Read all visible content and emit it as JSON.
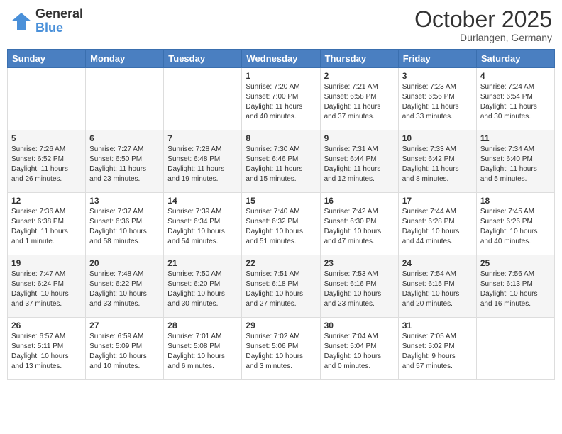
{
  "header": {
    "logo": {
      "general": "General",
      "blue": "Blue"
    },
    "title": "October 2025",
    "subtitle": "Durlangen, Germany"
  },
  "weekdays": [
    "Sunday",
    "Monday",
    "Tuesday",
    "Wednesday",
    "Thursday",
    "Friday",
    "Saturday"
  ],
  "weeks": [
    [
      {
        "day": "",
        "info": ""
      },
      {
        "day": "",
        "info": ""
      },
      {
        "day": "",
        "info": ""
      },
      {
        "day": "1",
        "info": "Sunrise: 7:20 AM\nSunset: 7:00 PM\nDaylight: 11 hours\nand 40 minutes."
      },
      {
        "day": "2",
        "info": "Sunrise: 7:21 AM\nSunset: 6:58 PM\nDaylight: 11 hours\nand 37 minutes."
      },
      {
        "day": "3",
        "info": "Sunrise: 7:23 AM\nSunset: 6:56 PM\nDaylight: 11 hours\nand 33 minutes."
      },
      {
        "day": "4",
        "info": "Sunrise: 7:24 AM\nSunset: 6:54 PM\nDaylight: 11 hours\nand 30 minutes."
      }
    ],
    [
      {
        "day": "5",
        "info": "Sunrise: 7:26 AM\nSunset: 6:52 PM\nDaylight: 11 hours\nand 26 minutes."
      },
      {
        "day": "6",
        "info": "Sunrise: 7:27 AM\nSunset: 6:50 PM\nDaylight: 11 hours\nand 23 minutes."
      },
      {
        "day": "7",
        "info": "Sunrise: 7:28 AM\nSunset: 6:48 PM\nDaylight: 11 hours\nand 19 minutes."
      },
      {
        "day": "8",
        "info": "Sunrise: 7:30 AM\nSunset: 6:46 PM\nDaylight: 11 hours\nand 15 minutes."
      },
      {
        "day": "9",
        "info": "Sunrise: 7:31 AM\nSunset: 6:44 PM\nDaylight: 11 hours\nand 12 minutes."
      },
      {
        "day": "10",
        "info": "Sunrise: 7:33 AM\nSunset: 6:42 PM\nDaylight: 11 hours\nand 8 minutes."
      },
      {
        "day": "11",
        "info": "Sunrise: 7:34 AM\nSunset: 6:40 PM\nDaylight: 11 hours\nand 5 minutes."
      }
    ],
    [
      {
        "day": "12",
        "info": "Sunrise: 7:36 AM\nSunset: 6:38 PM\nDaylight: 11 hours\nand 1 minute."
      },
      {
        "day": "13",
        "info": "Sunrise: 7:37 AM\nSunset: 6:36 PM\nDaylight: 10 hours\nand 58 minutes."
      },
      {
        "day": "14",
        "info": "Sunrise: 7:39 AM\nSunset: 6:34 PM\nDaylight: 10 hours\nand 54 minutes."
      },
      {
        "day": "15",
        "info": "Sunrise: 7:40 AM\nSunset: 6:32 PM\nDaylight: 10 hours\nand 51 minutes."
      },
      {
        "day": "16",
        "info": "Sunrise: 7:42 AM\nSunset: 6:30 PM\nDaylight: 10 hours\nand 47 minutes."
      },
      {
        "day": "17",
        "info": "Sunrise: 7:44 AM\nSunset: 6:28 PM\nDaylight: 10 hours\nand 44 minutes."
      },
      {
        "day": "18",
        "info": "Sunrise: 7:45 AM\nSunset: 6:26 PM\nDaylight: 10 hours\nand 40 minutes."
      }
    ],
    [
      {
        "day": "19",
        "info": "Sunrise: 7:47 AM\nSunset: 6:24 PM\nDaylight: 10 hours\nand 37 minutes."
      },
      {
        "day": "20",
        "info": "Sunrise: 7:48 AM\nSunset: 6:22 PM\nDaylight: 10 hours\nand 33 minutes."
      },
      {
        "day": "21",
        "info": "Sunrise: 7:50 AM\nSunset: 6:20 PM\nDaylight: 10 hours\nand 30 minutes."
      },
      {
        "day": "22",
        "info": "Sunrise: 7:51 AM\nSunset: 6:18 PM\nDaylight: 10 hours\nand 27 minutes."
      },
      {
        "day": "23",
        "info": "Sunrise: 7:53 AM\nSunset: 6:16 PM\nDaylight: 10 hours\nand 23 minutes."
      },
      {
        "day": "24",
        "info": "Sunrise: 7:54 AM\nSunset: 6:15 PM\nDaylight: 10 hours\nand 20 minutes."
      },
      {
        "day": "25",
        "info": "Sunrise: 7:56 AM\nSunset: 6:13 PM\nDaylight: 10 hours\nand 16 minutes."
      }
    ],
    [
      {
        "day": "26",
        "info": "Sunrise: 6:57 AM\nSunset: 5:11 PM\nDaylight: 10 hours\nand 13 minutes."
      },
      {
        "day": "27",
        "info": "Sunrise: 6:59 AM\nSunset: 5:09 PM\nDaylight: 10 hours\nand 10 minutes."
      },
      {
        "day": "28",
        "info": "Sunrise: 7:01 AM\nSunset: 5:08 PM\nDaylight: 10 hours\nand 6 minutes."
      },
      {
        "day": "29",
        "info": "Sunrise: 7:02 AM\nSunset: 5:06 PM\nDaylight: 10 hours\nand 3 minutes."
      },
      {
        "day": "30",
        "info": "Sunrise: 7:04 AM\nSunset: 5:04 PM\nDaylight: 10 hours\nand 0 minutes."
      },
      {
        "day": "31",
        "info": "Sunrise: 7:05 AM\nSunset: 5:02 PM\nDaylight: 9 hours\nand 57 minutes."
      },
      {
        "day": "",
        "info": ""
      }
    ]
  ]
}
